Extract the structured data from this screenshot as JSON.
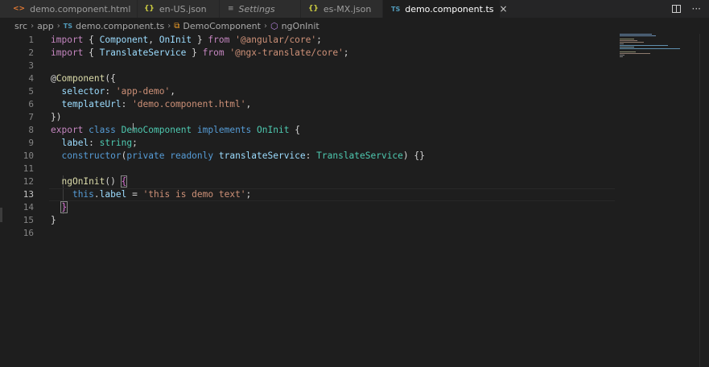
{
  "tabs": [
    {
      "label": "demo.component.html",
      "icon": "html-file-icon",
      "glyph": "<>",
      "italic": false,
      "active": false
    },
    {
      "label": "en-US.json",
      "icon": "json-file-icon",
      "glyph": "{}",
      "italic": false,
      "active": false
    },
    {
      "label": "Settings",
      "icon": "settings-icon",
      "glyph": "≡",
      "italic": true,
      "active": false
    },
    {
      "label": "es-MX.json",
      "icon": "json-file-icon",
      "glyph": "{}",
      "italic": false,
      "active": false
    },
    {
      "label": "demo.component.ts",
      "icon": "typescript-file-icon",
      "glyph": "TS",
      "italic": false,
      "active": true
    }
  ],
  "tab_actions": {
    "split": "split-editor-icon",
    "more": "···"
  },
  "close_glyph": "×",
  "breadcrumb": {
    "items": [
      "src",
      "app",
      "demo.component.ts",
      "DemoComponent",
      "ngOnInit"
    ],
    "ts_glyph": "TS",
    "separator": "›"
  },
  "editor": {
    "current_line": 13,
    "line_numbers": [
      "1",
      "2",
      "3",
      "4",
      "5",
      "6",
      "7",
      "8",
      "9",
      "10",
      "11",
      "12",
      "13",
      "14",
      "15",
      "16"
    ]
  },
  "colors": {
    "background": "#1e1e1e",
    "tabbar": "#252526",
    "keyword": "#569cd6",
    "control_keyword": "#c586c0",
    "type": "#4ec9b0",
    "string": "#ce9178",
    "function": "#dcdcaa",
    "variable": "#9cdcfe"
  }
}
